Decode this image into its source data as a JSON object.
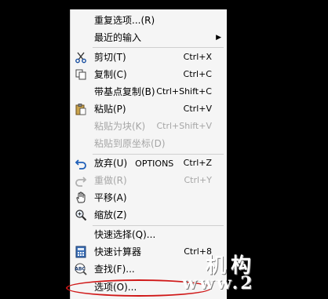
{
  "menu": {
    "repeat": {
      "label": "重复选项...(R)"
    },
    "recent_input": {
      "label": "最近的输入",
      "submenu_arrow": "▶"
    },
    "cut": {
      "label": "剪切(T)",
      "shortcut": "Ctrl+X",
      "icon": "scissors-icon"
    },
    "copy": {
      "label": "复制(C)",
      "shortcut": "Ctrl+C",
      "icon": "copy-icon"
    },
    "copy_base": {
      "label": "带基点复制(B)",
      "shortcut": "Ctrl+Shift+C"
    },
    "paste": {
      "label": "粘贴(P)",
      "shortcut": "Ctrl+V",
      "icon": "clipboard-icon"
    },
    "paste_block": {
      "label": "粘贴为块(K)",
      "shortcut": "Ctrl+Shift+V"
    },
    "paste_orig": {
      "label": "粘贴到原坐标(D)"
    },
    "undo": {
      "label": "放弃(U)",
      "extra": "OPTIONS",
      "shortcut": "Ctrl+Z",
      "icon": "undo-icon"
    },
    "redo": {
      "label": "重做(R)",
      "shortcut": "Ctrl+Y",
      "icon": "redo-icon"
    },
    "pan": {
      "label": "平移(A)",
      "icon": "hand-icon"
    },
    "zoom": {
      "label": "缩放(Z)",
      "icon": "zoom-icon"
    },
    "quick_select": {
      "label": "快速选择(Q)..."
    },
    "quickcalc": {
      "label": "快速计算器",
      "shortcut": "Ctrl+8",
      "icon": "calculator-icon"
    },
    "find": {
      "label": "查找(F)...",
      "icon": "find-abc-icon"
    },
    "options": {
      "label": "选项(O)..."
    }
  },
  "watermark": {
    "main": "机构",
    "url": "www.2"
  },
  "colors": {
    "background": "#000000",
    "menu_bg": "#f5f5f5",
    "disabled_text": "#a6a6a6",
    "highlight": "#d01818"
  }
}
